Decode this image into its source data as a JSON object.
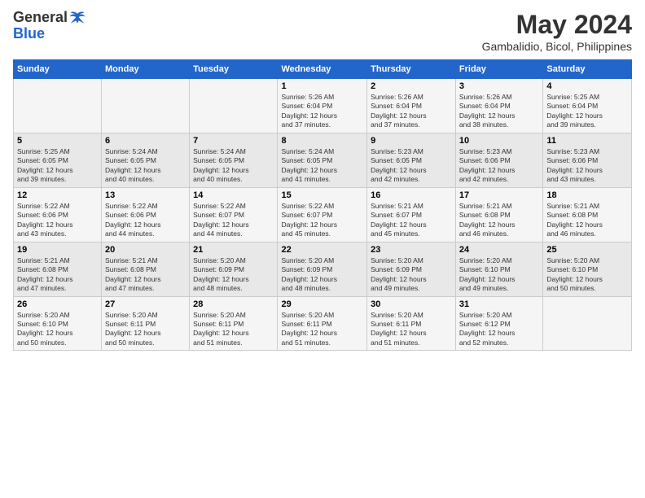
{
  "logo": {
    "general": "General",
    "blue": "Blue"
  },
  "title": "May 2024",
  "subtitle": "Gambalidio, Bicol, Philippines",
  "days_header": [
    "Sunday",
    "Monday",
    "Tuesday",
    "Wednesday",
    "Thursday",
    "Friday",
    "Saturday"
  ],
  "weeks": [
    [
      {
        "num": "",
        "info": ""
      },
      {
        "num": "",
        "info": ""
      },
      {
        "num": "",
        "info": ""
      },
      {
        "num": "1",
        "info": "Sunrise: 5:26 AM\nSunset: 6:04 PM\nDaylight: 12 hours\nand 37 minutes."
      },
      {
        "num": "2",
        "info": "Sunrise: 5:26 AM\nSunset: 6:04 PM\nDaylight: 12 hours\nand 37 minutes."
      },
      {
        "num": "3",
        "info": "Sunrise: 5:26 AM\nSunset: 6:04 PM\nDaylight: 12 hours\nand 38 minutes."
      },
      {
        "num": "4",
        "info": "Sunrise: 5:25 AM\nSunset: 6:04 PM\nDaylight: 12 hours\nand 39 minutes."
      }
    ],
    [
      {
        "num": "5",
        "info": "Sunrise: 5:25 AM\nSunset: 6:05 PM\nDaylight: 12 hours\nand 39 minutes."
      },
      {
        "num": "6",
        "info": "Sunrise: 5:24 AM\nSunset: 6:05 PM\nDaylight: 12 hours\nand 40 minutes."
      },
      {
        "num": "7",
        "info": "Sunrise: 5:24 AM\nSunset: 6:05 PM\nDaylight: 12 hours\nand 40 minutes."
      },
      {
        "num": "8",
        "info": "Sunrise: 5:24 AM\nSunset: 6:05 PM\nDaylight: 12 hours\nand 41 minutes."
      },
      {
        "num": "9",
        "info": "Sunrise: 5:23 AM\nSunset: 6:05 PM\nDaylight: 12 hours\nand 42 minutes."
      },
      {
        "num": "10",
        "info": "Sunrise: 5:23 AM\nSunset: 6:06 PM\nDaylight: 12 hours\nand 42 minutes."
      },
      {
        "num": "11",
        "info": "Sunrise: 5:23 AM\nSunset: 6:06 PM\nDaylight: 12 hours\nand 43 minutes."
      }
    ],
    [
      {
        "num": "12",
        "info": "Sunrise: 5:22 AM\nSunset: 6:06 PM\nDaylight: 12 hours\nand 43 minutes."
      },
      {
        "num": "13",
        "info": "Sunrise: 5:22 AM\nSunset: 6:06 PM\nDaylight: 12 hours\nand 44 minutes."
      },
      {
        "num": "14",
        "info": "Sunrise: 5:22 AM\nSunset: 6:07 PM\nDaylight: 12 hours\nand 44 minutes."
      },
      {
        "num": "15",
        "info": "Sunrise: 5:22 AM\nSunset: 6:07 PM\nDaylight: 12 hours\nand 45 minutes."
      },
      {
        "num": "16",
        "info": "Sunrise: 5:21 AM\nSunset: 6:07 PM\nDaylight: 12 hours\nand 45 minutes."
      },
      {
        "num": "17",
        "info": "Sunrise: 5:21 AM\nSunset: 6:08 PM\nDaylight: 12 hours\nand 46 minutes."
      },
      {
        "num": "18",
        "info": "Sunrise: 5:21 AM\nSunset: 6:08 PM\nDaylight: 12 hours\nand 46 minutes."
      }
    ],
    [
      {
        "num": "19",
        "info": "Sunrise: 5:21 AM\nSunset: 6:08 PM\nDaylight: 12 hours\nand 47 minutes."
      },
      {
        "num": "20",
        "info": "Sunrise: 5:21 AM\nSunset: 6:08 PM\nDaylight: 12 hours\nand 47 minutes."
      },
      {
        "num": "21",
        "info": "Sunrise: 5:20 AM\nSunset: 6:09 PM\nDaylight: 12 hours\nand 48 minutes."
      },
      {
        "num": "22",
        "info": "Sunrise: 5:20 AM\nSunset: 6:09 PM\nDaylight: 12 hours\nand 48 minutes."
      },
      {
        "num": "23",
        "info": "Sunrise: 5:20 AM\nSunset: 6:09 PM\nDaylight: 12 hours\nand 49 minutes."
      },
      {
        "num": "24",
        "info": "Sunrise: 5:20 AM\nSunset: 6:10 PM\nDaylight: 12 hours\nand 49 minutes."
      },
      {
        "num": "25",
        "info": "Sunrise: 5:20 AM\nSunset: 6:10 PM\nDaylight: 12 hours\nand 50 minutes."
      }
    ],
    [
      {
        "num": "26",
        "info": "Sunrise: 5:20 AM\nSunset: 6:10 PM\nDaylight: 12 hours\nand 50 minutes."
      },
      {
        "num": "27",
        "info": "Sunrise: 5:20 AM\nSunset: 6:11 PM\nDaylight: 12 hours\nand 50 minutes."
      },
      {
        "num": "28",
        "info": "Sunrise: 5:20 AM\nSunset: 6:11 PM\nDaylight: 12 hours\nand 51 minutes."
      },
      {
        "num": "29",
        "info": "Sunrise: 5:20 AM\nSunset: 6:11 PM\nDaylight: 12 hours\nand 51 minutes."
      },
      {
        "num": "30",
        "info": "Sunrise: 5:20 AM\nSunset: 6:11 PM\nDaylight: 12 hours\nand 51 minutes."
      },
      {
        "num": "31",
        "info": "Sunrise: 5:20 AM\nSunset: 6:12 PM\nDaylight: 12 hours\nand 52 minutes."
      },
      {
        "num": "",
        "info": ""
      }
    ]
  ]
}
